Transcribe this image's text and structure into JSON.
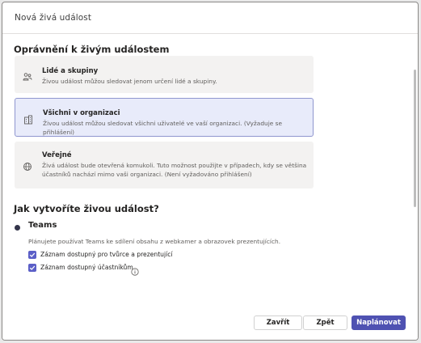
{
  "dialog": {
    "title": "Nová živá událost"
  },
  "permissions": {
    "heading": "Oprávnění k živým událostem",
    "options": [
      {
        "title": "Lidé a skupiny",
        "description": "Živou událost můžou sledovat jenom určení lidé a skupiny.",
        "icon": "people-icon",
        "selected": false
      },
      {
        "title": "Všichni v organizaci",
        "description": "Živou událost můžou sledovat všichni uživatelé ve vaší organizaci. (Vyžaduje se přihlášení)",
        "icon": "building-icon",
        "selected": true
      },
      {
        "title": "Veřejné",
        "description": "Živá událost bude otevřená komukoli. Tuto možnost použijte v případech, kdy se většina účastníků nachází mimo vaši organizaci. (Není vyžadováno přihlášení)",
        "icon": "globe-icon",
        "selected": false
      }
    ]
  },
  "production": {
    "heading": "Jak vytvoříte živou událost?",
    "teams": {
      "label": "Teams",
      "description": "Plánujete používat Teams ke sdílení obsahu z webkamer a obrazovek prezentujících.",
      "checkboxes": [
        {
          "label": "Záznam dostupný pro tvůrce a prezentující",
          "checked": true
        },
        {
          "label": "Záznam dostupný účastníkům",
          "checked": true
        }
      ]
    }
  },
  "footer": {
    "close_label": "Zavřít",
    "back_label": "Zpět",
    "schedule_label": "Naplánovat"
  },
  "colors": {
    "accent": "#4f52b2",
    "selected_bg": "#e8ebfa",
    "option_bg": "#f3f2f1"
  }
}
